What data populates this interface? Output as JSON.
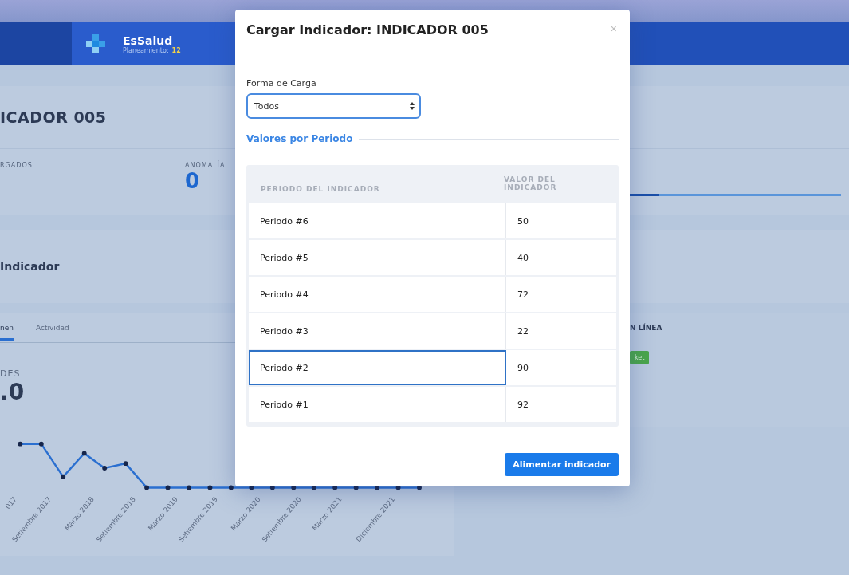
{
  "header": {
    "brand": "EsSalud",
    "subtitle": "Planeamiento:",
    "count": "12"
  },
  "page": {
    "title": "ICADOR 005",
    "stats": [
      {
        "label": "RGADOS"
      },
      {
        "label": "ANOMALÍA",
        "value": "0"
      }
    ],
    "progress": {
      "level": 0.54
    },
    "section_title": "Indicador",
    "tabs": [
      {
        "label": "nen",
        "selected": true
      },
      {
        "label": "Actividad",
        "selected": false
      }
    ],
    "metric": {
      "label": "DES",
      "value": ".0"
    },
    "chart_x_labels": [
      "017",
      "Setiembre 2017",
      "Marzo 2018",
      "Setiembre 2018",
      "Marzo 2019",
      "Setiembre 2019",
      "Marzo 2020",
      "Setiembre 2020",
      "Marzo 2021",
      "Diciembre 2021"
    ],
    "side": {
      "title": "N LÍNEA",
      "badge": "ket"
    }
  },
  "modal": {
    "title": "Cargar Indicador: INDICADOR 005",
    "close": "×",
    "field_label": "Forma de Carga",
    "select_value": "Todos",
    "section": "Valores por Periodo",
    "columns": [
      "PERIODO DEL INDICADOR",
      "VALOR DEL INDICADOR"
    ],
    "rows": [
      {
        "period": "Periodo #6",
        "value": "50",
        "focused": false
      },
      {
        "period": "Periodo #5",
        "value": "40",
        "focused": false
      },
      {
        "period": "Periodo #4",
        "value": "72",
        "focused": false
      },
      {
        "period": "Periodo #3",
        "value": "22",
        "focused": false
      },
      {
        "period": "Periodo #2",
        "value": "90",
        "focused": true
      },
      {
        "period": "Periodo #1",
        "value": "92",
        "focused": false
      }
    ],
    "button": "Alimentar indicador"
  }
}
